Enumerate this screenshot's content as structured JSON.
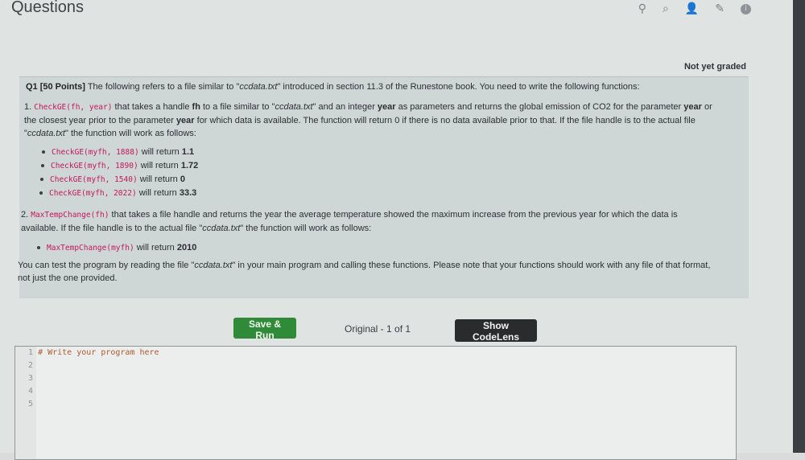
{
  "page_title": "Questions",
  "toolbar_icons": [
    "pin-icon",
    "search-icon",
    "user-icon",
    "pencil-icon",
    "info-icon"
  ],
  "status": "Not yet graded",
  "question": {
    "label": "Q1 [50 Points]",
    "intro_pre": " The following refers to a file similar to \"",
    "intro_file": "ccdata.txt",
    "intro_post": "\" introduced in section 11.3 of the Runestone book. You need to write the following functions:",
    "part1": {
      "num": "1. ",
      "sig": "CheckGE(fh, year)",
      "l1_a": " that takes a handle ",
      "l1_b": "fh",
      "l1_c": " to a file similar to \"",
      "l1_file": "ccdata.txt",
      "l1_d": "\" and an integer ",
      "l1_e": "year",
      "l1_f": " as parameters and returns the global emission of CO2 for the parameter ",
      "l1_g": "year",
      "l1_h": " or",
      "l2": "the closest year prior to the parameter ",
      "l2_b": "year",
      "l2_c": " for which data is available. The function will return 0 if there is no data available prior to that. If the file handle is to the actual file",
      "l3_q": "\"",
      "l3_file": "ccdata.txt",
      "l3_rest": "\" the function will work as follows:",
      "examples": [
        {
          "code": "CheckGE(myfh, 1888)",
          "text": " will return ",
          "value": "1.1"
        },
        {
          "code": "CheckGE(myfh, 1890)",
          "text": " will return ",
          "value": "1.72"
        },
        {
          "code": "CheckGE(myfh, 1540)",
          "text": " will return ",
          "value": "0"
        },
        {
          "code": "CheckGE(myfh, 2022)",
          "text": " will return ",
          "value": "33.3"
        }
      ]
    },
    "part2": {
      "num": "2. ",
      "sig": "MaxTempChange(fh)",
      "l1": " that takes a file handle and returns the year the average temperature showed the maximum increase from the previous year for which the data is",
      "l2_a": "available. If the file handle is to the actual file \"",
      "l2_file": "ccdata.txt",
      "l2_b": "\" the function will work as follows:",
      "example": {
        "code": "MaxTempChange(myfh)",
        "text": " will return ",
        "value": "2010"
      }
    },
    "footer_l1_a": "You can test the program by reading the file \"",
    "footer_file": "ccdata.txt",
    "footer_l1_b": "\" in your main program and calling these functions. Please note that your functions should work with any file of that format,",
    "footer_l2": "not just the one provided."
  },
  "buttons": {
    "save_run": "Save & Run",
    "original": "Original - 1 of 1",
    "codelens": "Show CodeLens"
  },
  "editor": {
    "lines": [
      {
        "num": "1",
        "code": "# Write your program here"
      },
      {
        "num": "2",
        "code": ""
      },
      {
        "num": "3",
        "code": ""
      },
      {
        "num": "4",
        "code": ""
      },
      {
        "num": "5",
        "code": ""
      }
    ]
  }
}
